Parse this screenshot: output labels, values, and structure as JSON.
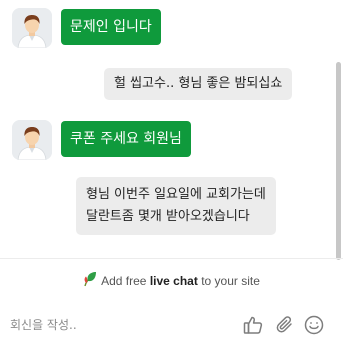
{
  "messages": [
    {
      "sender": "agent",
      "text": "문제인 입니다"
    },
    {
      "sender": "visitor",
      "text": "헐 씹고수.. 형님 좋은 밤되십쇼"
    },
    {
      "sender": "agent",
      "text": "쿠폰 주세요 회원님"
    },
    {
      "sender": "visitor",
      "lines": [
        "형님 이번주 일요일에 교회가는데",
        "달란트좀 몇개 받아오겠습니다"
      ]
    }
  ],
  "branding": {
    "prefix": "Add free",
    "highlight": "live chat",
    "suffix": "to your site"
  },
  "composer": {
    "placeholder": "회신을 작성.."
  },
  "icons": {
    "thumbs_up": "thumbs-up-icon",
    "attachment": "paperclip-icon",
    "emoji": "smiley-icon",
    "brand": "leaf-icon"
  },
  "colors": {
    "agent_bubble": "#0f9a3c",
    "visitor_bubble": "#ececec"
  }
}
